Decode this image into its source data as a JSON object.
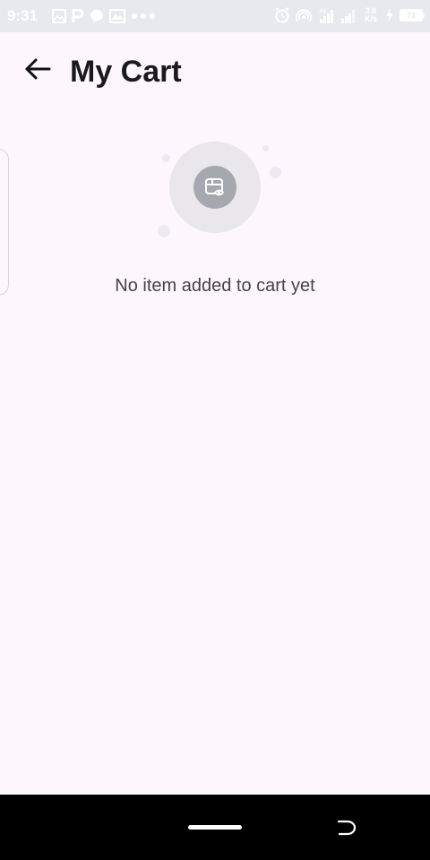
{
  "status_bar": {
    "time": "9:31",
    "left_icons": [
      "gallery-icon",
      "p-app-icon",
      "chat-icon",
      "image-icon",
      "more-dots-icon"
    ],
    "right_icons": [
      "alarm-icon",
      "hotspot-icon",
      "signal-4g-icon",
      "signal-icon",
      "charging-icon"
    ],
    "network_speed_value": "3.8",
    "network_speed_unit": "K/s",
    "battery_level": "73"
  },
  "header": {
    "back_icon": "arrow-left-icon",
    "title": "My Cart"
  },
  "empty_state": {
    "icon": "cart-view-icon",
    "message": "No item added to cart yet"
  },
  "nav_bar": {
    "home_indicator": "home-pill",
    "back_icon": "back-gesture-icon"
  },
  "colors": {
    "background": "#fdf7fd",
    "status_bar": "#e7e9ee",
    "title_text": "#1a1a1a",
    "empty_circle": "#e9e7eb",
    "empty_icon_bg": "#a5a8ae",
    "nav_bar": "#000000"
  }
}
